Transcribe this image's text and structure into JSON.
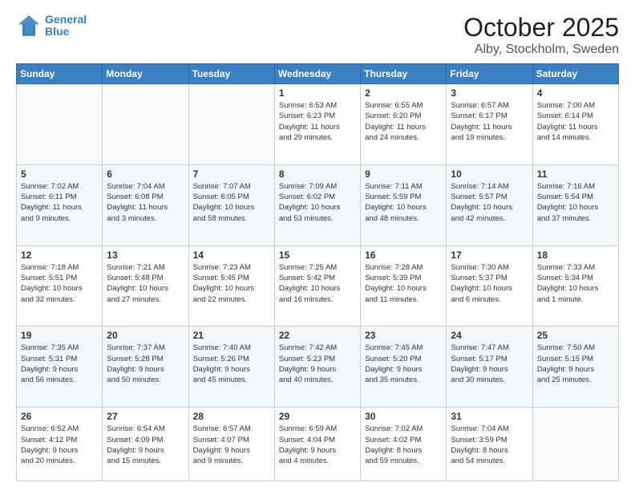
{
  "header": {
    "logo_line1": "General",
    "logo_line2": "Blue",
    "title": "October 2025",
    "subtitle": "Alby, Stockholm, Sweden"
  },
  "days_of_week": [
    "Sunday",
    "Monday",
    "Tuesday",
    "Wednesday",
    "Thursday",
    "Friday",
    "Saturday"
  ],
  "weeks": [
    [
      {
        "num": "",
        "info": ""
      },
      {
        "num": "",
        "info": ""
      },
      {
        "num": "",
        "info": ""
      },
      {
        "num": "1",
        "info": "Sunrise: 6:53 AM\nSunset: 6:23 PM\nDaylight: 11 hours\nand 29 minutes."
      },
      {
        "num": "2",
        "info": "Sunrise: 6:55 AM\nSunset: 6:20 PM\nDaylight: 11 hours\nand 24 minutes."
      },
      {
        "num": "3",
        "info": "Sunrise: 6:57 AM\nSunset: 6:17 PM\nDaylight: 11 hours\nand 19 minutes."
      },
      {
        "num": "4",
        "info": "Sunrise: 7:00 AM\nSunset: 6:14 PM\nDaylight: 11 hours\nand 14 minutes."
      }
    ],
    [
      {
        "num": "5",
        "info": "Sunrise: 7:02 AM\nSunset: 6:11 PM\nDaylight: 11 hours\nand 9 minutes."
      },
      {
        "num": "6",
        "info": "Sunrise: 7:04 AM\nSunset: 6:08 PM\nDaylight: 11 hours\nand 3 minutes."
      },
      {
        "num": "7",
        "info": "Sunrise: 7:07 AM\nSunset: 6:05 PM\nDaylight: 10 hours\nand 58 minutes."
      },
      {
        "num": "8",
        "info": "Sunrise: 7:09 AM\nSunset: 6:02 PM\nDaylight: 10 hours\nand 53 minutes."
      },
      {
        "num": "9",
        "info": "Sunrise: 7:11 AM\nSunset: 5:59 PM\nDaylight: 10 hours\nand 48 minutes."
      },
      {
        "num": "10",
        "info": "Sunrise: 7:14 AM\nSunset: 5:57 PM\nDaylight: 10 hours\nand 42 minutes."
      },
      {
        "num": "11",
        "info": "Sunrise: 7:16 AM\nSunset: 5:54 PM\nDaylight: 10 hours\nand 37 minutes."
      }
    ],
    [
      {
        "num": "12",
        "info": "Sunrise: 7:18 AM\nSunset: 5:51 PM\nDaylight: 10 hours\nand 32 minutes."
      },
      {
        "num": "13",
        "info": "Sunrise: 7:21 AM\nSunset: 5:48 PM\nDaylight: 10 hours\nand 27 minutes."
      },
      {
        "num": "14",
        "info": "Sunrise: 7:23 AM\nSunset: 5:45 PM\nDaylight: 10 hours\nand 22 minutes."
      },
      {
        "num": "15",
        "info": "Sunrise: 7:25 AM\nSunset: 5:42 PM\nDaylight: 10 hours\nand 16 minutes."
      },
      {
        "num": "16",
        "info": "Sunrise: 7:28 AM\nSunset: 5:39 PM\nDaylight: 10 hours\nand 11 minutes."
      },
      {
        "num": "17",
        "info": "Sunrise: 7:30 AM\nSunset: 5:37 PM\nDaylight: 10 hours\nand 6 minutes."
      },
      {
        "num": "18",
        "info": "Sunrise: 7:33 AM\nSunset: 5:34 PM\nDaylight: 10 hours\nand 1 minute."
      }
    ],
    [
      {
        "num": "19",
        "info": "Sunrise: 7:35 AM\nSunset: 5:31 PM\nDaylight: 9 hours\nand 56 minutes."
      },
      {
        "num": "20",
        "info": "Sunrise: 7:37 AM\nSunset: 5:28 PM\nDaylight: 9 hours\nand 50 minutes."
      },
      {
        "num": "21",
        "info": "Sunrise: 7:40 AM\nSunset: 5:26 PM\nDaylight: 9 hours\nand 45 minutes."
      },
      {
        "num": "22",
        "info": "Sunrise: 7:42 AM\nSunset: 5:23 PM\nDaylight: 9 hours\nand 40 minutes."
      },
      {
        "num": "23",
        "info": "Sunrise: 7:45 AM\nSunset: 5:20 PM\nDaylight: 9 hours\nand 35 minutes."
      },
      {
        "num": "24",
        "info": "Sunrise: 7:47 AM\nSunset: 5:17 PM\nDaylight: 9 hours\nand 30 minutes."
      },
      {
        "num": "25",
        "info": "Sunrise: 7:50 AM\nSunset: 5:15 PM\nDaylight: 9 hours\nand 25 minutes."
      }
    ],
    [
      {
        "num": "26",
        "info": "Sunrise: 6:52 AM\nSunset: 4:12 PM\nDaylight: 9 hours\nand 20 minutes."
      },
      {
        "num": "27",
        "info": "Sunrise: 6:54 AM\nSunset: 4:09 PM\nDaylight: 9 hours\nand 15 minutes."
      },
      {
        "num": "28",
        "info": "Sunrise: 6:57 AM\nSunset: 4:07 PM\nDaylight: 9 hours\nand 9 minutes."
      },
      {
        "num": "29",
        "info": "Sunrise: 6:59 AM\nSunset: 4:04 PM\nDaylight: 9 hours\nand 4 minutes."
      },
      {
        "num": "30",
        "info": "Sunrise: 7:02 AM\nSunset: 4:02 PM\nDaylight: 8 hours\nand 59 minutes."
      },
      {
        "num": "31",
        "info": "Sunrise: 7:04 AM\nSunset: 3:59 PM\nDaylight: 8 hours\nand 54 minutes."
      },
      {
        "num": "",
        "info": ""
      }
    ]
  ]
}
